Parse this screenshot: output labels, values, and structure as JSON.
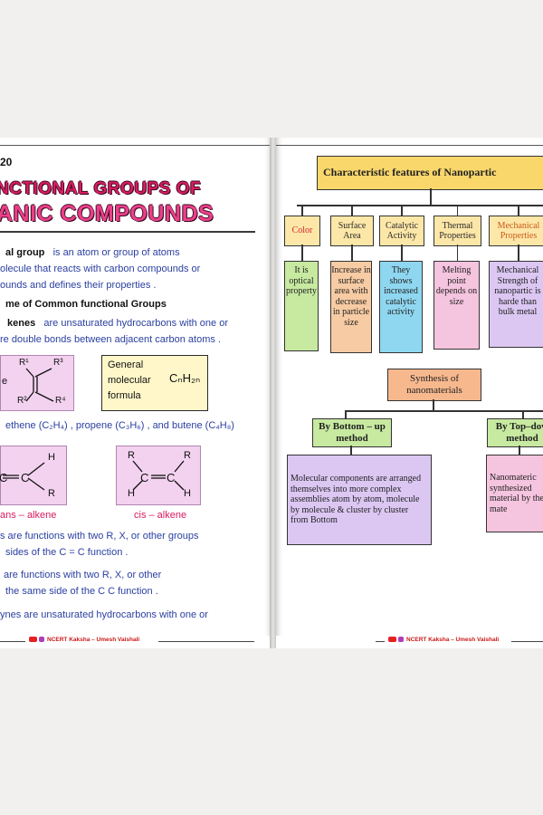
{
  "left_page": {
    "page_number": "20",
    "title_line1": "NCTIONAL GROUPS OF",
    "title_line2": "ANIC COMPOUNDS",
    "def_line1_a": "al group",
    "def_line1_b": "is an atom or group of atoms",
    "def_line2": "olecule that reacts with carbon compounds or",
    "def_line3": "ounds and defines their properties .",
    "heading": "me of Common functional Groups",
    "alkene_line1_a": "kenes",
    "alkene_line1_b": "are unsaturated hydrocarbons with one or",
    "alkene_line2": "re double bonds between adjacent carbon atoms .",
    "struct_label": "e",
    "struct_r1": "R¹",
    "struct_r2": "R²",
    "struct_r3": "R³",
    "struct_r4": "R⁴",
    "formula_line1": "General",
    "formula_line2": "molecular",
    "formula_line3": "formula",
    "formula_expr": "CₙH₂ₙ",
    "examples": "ethene (C₂H₄) , propene (C₃H₆) , and butene (C₄H₈)",
    "trans_h": "H",
    "trans_r": "R",
    "trans_label": "ans – alkene",
    "cis_r": "R",
    "cis_h": "H",
    "cis_label": "cis – alkene",
    "trans_desc1": "s are functions with two R, X, or other groups",
    "trans_desc2": "sides of the C = C function .",
    "cis_desc1": "are functions with two R, X, or other",
    "cis_desc2": "the same side of the C C function .",
    "alkyne_line": "ynes are unsaturated hydrocarbons with one or",
    "footer": "NCERT Kaksha – Umesh Vaishali"
  },
  "right_page": {
    "main_title": "Characteristic features of Nanopartic",
    "categories": [
      {
        "label": "Color",
        "desc": "It is optical property",
        "color": "#c7e9a0",
        "label_color": "#d0202a"
      },
      {
        "label": "Surface Area",
        "desc": "Increase in surface area with decrease in particle size",
        "color": "#f7cba3",
        "label_color": "#2a2a2a"
      },
      {
        "label": "Catalytic Activity",
        "desc": "They shows increased catalytic activity",
        "color": "#8fd7f0",
        "label_color": "#2a2a2a"
      },
      {
        "label": "Thermal Properties",
        "desc": "Melting point depends on size",
        "color": "#f5c4df",
        "label_color": "#2a2a2a"
      },
      {
        "label": "Mechanical Properties",
        "desc": "Mechanical Strength of nanopartic is harde than bulk metal",
        "color": "#dcc7f3",
        "label_color": "#c95a1a"
      }
    ],
    "synthesis_title": "Synthesis of nanomaterials",
    "bottom_up": {
      "label": "By Bottom – up method",
      "desc": "Molecular components are arranged themselves into more complex assemblies atom by atom, molecule by molecule & cluster by cluster from Bottom"
    },
    "top_down": {
      "label": "By Top–dow method",
      "desc": "Nanomateric synthesized material by the mate"
    },
    "footer": "NCERT Kaksha – Umesh Vaishali"
  },
  "colors": {
    "title_pink": "#d81b60",
    "text_blue": "#2a3fa0",
    "title_box": "#f9d76b",
    "label_bg": "#fde7a8",
    "synthesis_bg": "#f7b88e",
    "method_bg": "#c7e9a0",
    "bottom_desc_bg": "#dcc7f3",
    "top_desc_bg": "#f5c4df"
  }
}
